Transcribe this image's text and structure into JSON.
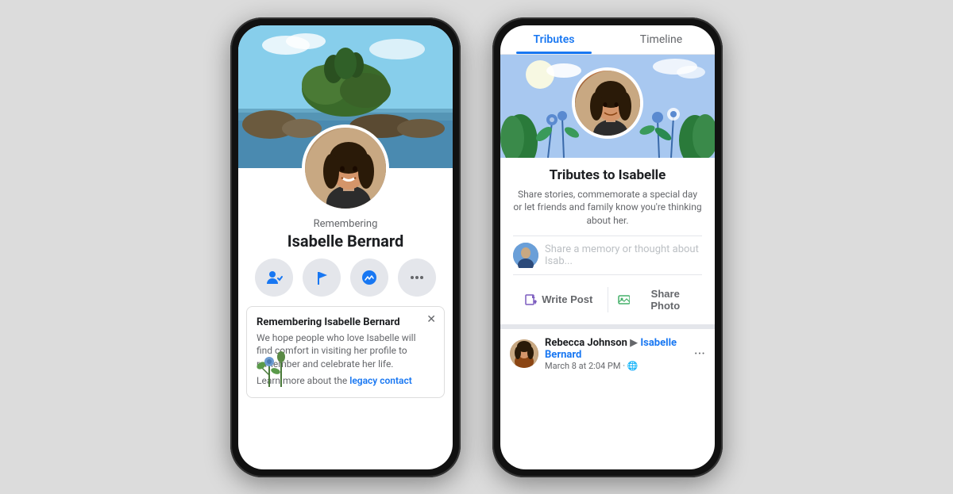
{
  "scene": {
    "background_color": "#dcdcdc"
  },
  "left_phone": {
    "profile": {
      "remembering_label": "Remembering",
      "name": "Isabelle Bernard"
    },
    "action_buttons": [
      {
        "icon": "👤✓",
        "label": "friends"
      },
      {
        "icon": "🚩",
        "label": "flag"
      },
      {
        "icon": "💬",
        "label": "messenger"
      },
      {
        "icon": "···",
        "label": "more"
      }
    ],
    "notification": {
      "title": "Remembering Isabelle Bernard",
      "text": "We hope people who love Isabelle will find comfort in visiting her profile to remember and celebrate her life.",
      "link_text": "Learn more about the",
      "link_anchor": "legacy contact",
      "close_symbol": "✕"
    }
  },
  "right_phone": {
    "tabs": [
      {
        "label": "Tributes",
        "active": true
      },
      {
        "label": "Timeline",
        "active": false
      }
    ],
    "tribute_section": {
      "title": "Tributes to Isabelle",
      "description": "Share stories, commemorate a special day or let friends and family know you're thinking about her.",
      "share_placeholder": "Share a memory or thought about Isab...",
      "write_post_label": "Write Post",
      "share_photo_label": "Share Photo"
    },
    "post": {
      "author": "Rebecca Johnson",
      "to": "Isabelle Bernard",
      "time": "March 8 at 2:04 PM",
      "audience": "🌐",
      "more_icon": "···"
    }
  },
  "icons": {
    "friends_check": "✓",
    "flag": "⚑",
    "messenger": "⚡",
    "more": "•••",
    "close": "✕",
    "write_post": "✏",
    "share_photo": "🖼",
    "globe": "🌐"
  }
}
